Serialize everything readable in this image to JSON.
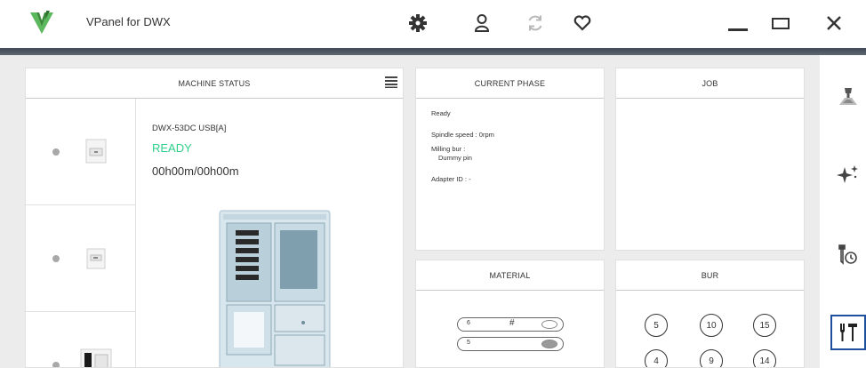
{
  "app": {
    "title": "VPanel for DWX"
  },
  "toolbar": {
    "icons": [
      "gear-icon",
      "user-icon",
      "refresh-icon",
      "heart-icon"
    ]
  },
  "window_controls": [
    "minimize-icon",
    "maximize-icon",
    "close-icon"
  ],
  "machine_status": {
    "header": "MACHINE STATUS",
    "selected": {
      "name": "DWX-53DC USB[A]",
      "status": "READY",
      "time": "00h00m/00h00m"
    },
    "status_color": "#2ed08a"
  },
  "current_phase": {
    "header": "CURRENT PHASE",
    "state": "Ready",
    "spindle_speed": "Spindle speed : 0rpm",
    "milling_bur_label": "Milling bur :",
    "milling_bur_value": "Dummy pin",
    "adapter_id": "Adapter ID : -"
  },
  "job": {
    "header": "JOB"
  },
  "material": {
    "header": "MATERIAL",
    "slots": [
      {
        "number": "6",
        "symbol": "#"
      },
      {
        "number": "5",
        "symbol": ""
      }
    ]
  },
  "bur": {
    "header": "BUR",
    "positions": [
      "5",
      "10",
      "15",
      "4",
      "9",
      "14"
    ]
  },
  "sidebar": {
    "items": [
      "milling-icon",
      "sparkle-icon",
      "tool-timer-icon",
      "maintenance-tools-icon"
    ],
    "active_color": "#1e4f9c"
  }
}
